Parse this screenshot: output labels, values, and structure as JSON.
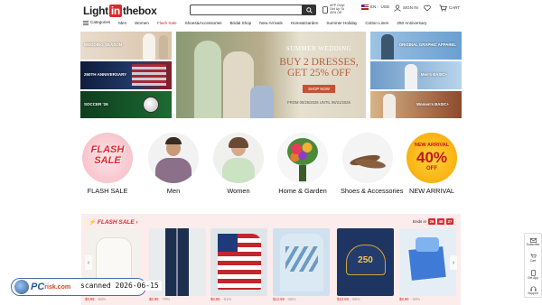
{
  "header": {
    "logo_a": "Light",
    "logo_b": "in",
    "logo_c": "thebox",
    "app_promo": "APP Only! Get Up To 40% Off",
    "language": "EN",
    "currency": "USD",
    "sign_in": "SIGN IN",
    "cart": "CART"
  },
  "nav": {
    "items": [
      {
        "label": "Categories"
      },
      {
        "label": "Men"
      },
      {
        "label": "Women"
      },
      {
        "label": "Flash Sale"
      },
      {
        "label": "Shoes&Accessories"
      },
      {
        "label": "Bridal Shop"
      },
      {
        "label": "New Arrivals"
      },
      {
        "label": "Home&Garden"
      },
      {
        "label": "Summer Holiday"
      },
      {
        "label": "Cotton Linen"
      },
      {
        "label": "250 Anniversary"
      }
    ]
  },
  "banners": {
    "left": [
      "WEDDING SEASON",
      "250TH ANNIVERSARY",
      "SOCCER '26"
    ],
    "main": {
      "title": "SUMMER WEDDING",
      "line1": "BUY 2 DRESSES,",
      "line2": "GET 25% OFF",
      "cta": "SHOP NOW",
      "dates": "FROM 05/25/2026 UNTIL 06/21/2026"
    },
    "right": [
      "ORIGINAL GRAPHIC APPAREL",
      "Men's BASIC+",
      "Women's BASIC+"
    ]
  },
  "categories": [
    {
      "label": "FLASH SALE",
      "badge": "FLASH SALE"
    },
    {
      "label": "Men"
    },
    {
      "label": "Women"
    },
    {
      "label": "Home & Garden"
    },
    {
      "label": "Shoes & Accessories"
    },
    {
      "label": "NEW ARRIVAL",
      "badge_top": "NEW ARRIVAL",
      "badge_pct": "40%",
      "badge_off": "OFF"
    }
  ],
  "flash_sale": {
    "title": "FLASH SALE",
    "ends_label": "Ends in",
    "timer": [
      "26",
      "48",
      "27"
    ],
    "products": [
      {
        "price": "$9.99",
        "off": "-58%"
      },
      {
        "price": "$8.99",
        "off": "-79%"
      },
      {
        "price": "$8.99",
        "off": "-61%"
      },
      {
        "price": "$12.99",
        "off": "-66%"
      },
      {
        "price": "$10.99",
        "off": "-59%"
      },
      {
        "price": "$8.99",
        "off": "-58%"
      }
    ],
    "hat_text": "250"
  },
  "side_tools": [
    "Subscribe",
    "Cart",
    "Get App",
    "Support"
  ],
  "watermark": {
    "brand": "PC",
    "brand2": "risk.com",
    "scanned": "scanned 2026-06-15"
  },
  "colors": {
    "accent": "#e0262b"
  }
}
